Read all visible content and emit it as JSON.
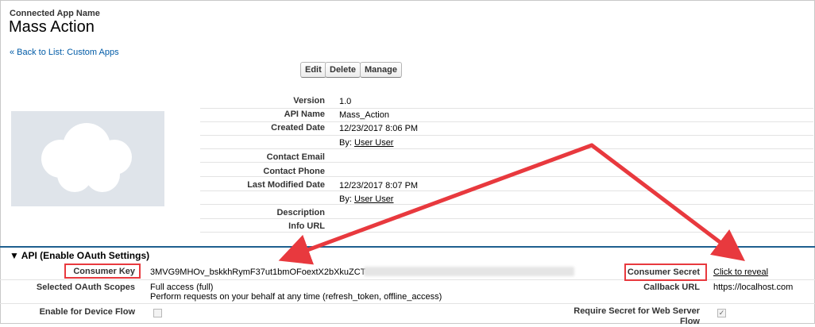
{
  "header": {
    "subtitle": "Connected App Name",
    "title": "Mass Action",
    "back_link": "« Back to List: Custom Apps"
  },
  "buttons": {
    "edit": "Edit",
    "delete": "Delete",
    "manage": "Manage"
  },
  "details": {
    "version_label": "Version",
    "version_value": "1.0",
    "api_name_label": "API Name",
    "api_name_value": "Mass_Action",
    "created_label": "Created Date",
    "created_value": "12/23/2017 8:06 PM",
    "created_by_prefix": "By:",
    "created_by_user": "User User",
    "contact_email_label": "Contact Email",
    "contact_phone_label": "Contact Phone",
    "modified_label": "Last Modified Date",
    "modified_value": "12/23/2017 8:07 PM",
    "modified_by_prefix": "By:",
    "modified_by_user": "User User",
    "description_label": "Description",
    "info_url_label": "Info URL"
  },
  "api": {
    "section_title": "API (Enable OAuth Settings)",
    "consumer_key_label": "Consumer Key",
    "consumer_key_value": "3MVG9MHOv_bskkhRymF37ut1bmOFoextX2bXkuZCT",
    "consumer_secret_label": "Consumer Secret",
    "consumer_secret_link": "Click to reveal",
    "scopes_label": "Selected OAuth Scopes",
    "scope_1": "Full access (full)",
    "scope_2": "Perform requests on your behalf at any time (refresh_token, offline_access)",
    "callback_label": "Callback URL",
    "callback_value": "https://localhost.com",
    "device_flow_label": "Enable for Device Flow",
    "require_secret_label_1": "Require Secret for Web Server",
    "require_secret_label_2": "Flow"
  },
  "colors": {
    "highlight": "#e8393e",
    "link": "#015ba7",
    "section_rule": "#1f5f8f"
  },
  "icons": [
    "cloud-logo",
    "triangle-down-icon",
    "checkbox-icon",
    "check-icon"
  ]
}
